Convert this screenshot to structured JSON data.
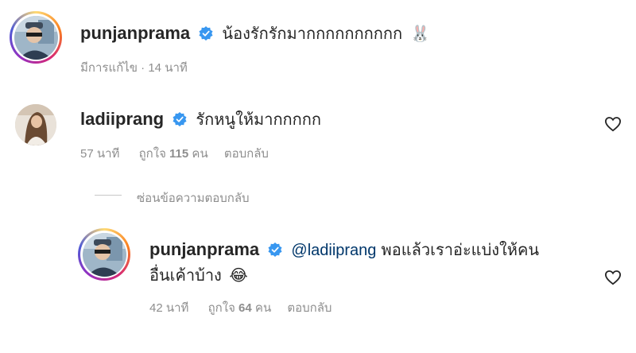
{
  "comments": [
    {
      "username": "punjanprama",
      "text": "น้องรักรักมากกกกกกกกกก",
      "emoji": "🐰",
      "edited_label": "มีการแก้ไข",
      "time": "14 นาที"
    },
    {
      "username": "ladiiprang",
      "text": "รักหนูให้มากกกกก",
      "time": "57 นาที",
      "likes_prefix": "ถูกใจ",
      "likes_count": "115",
      "likes_suffix": "คน",
      "reply_label": "ตอบกลับ"
    }
  ],
  "hide_replies_label": "ซ่อนข้อความตอบกลับ",
  "reply": {
    "username": "punjanprama",
    "mention": "@ladiiprang",
    "text_line1": "พอแล้วเราอ่ะแบ่งให้คน",
    "text_line2": "อื่นเค้าบ้าง",
    "emoji": "😂",
    "time": "42 นาที",
    "likes_prefix": "ถูกใจ",
    "likes_count": "64",
    "likes_suffix": "คน",
    "reply_label": "ตอบกลับ"
  },
  "colors": {
    "verified": "#3897f0",
    "text": "#262626",
    "meta": "#8e8e8e",
    "mention": "#00376b"
  }
}
